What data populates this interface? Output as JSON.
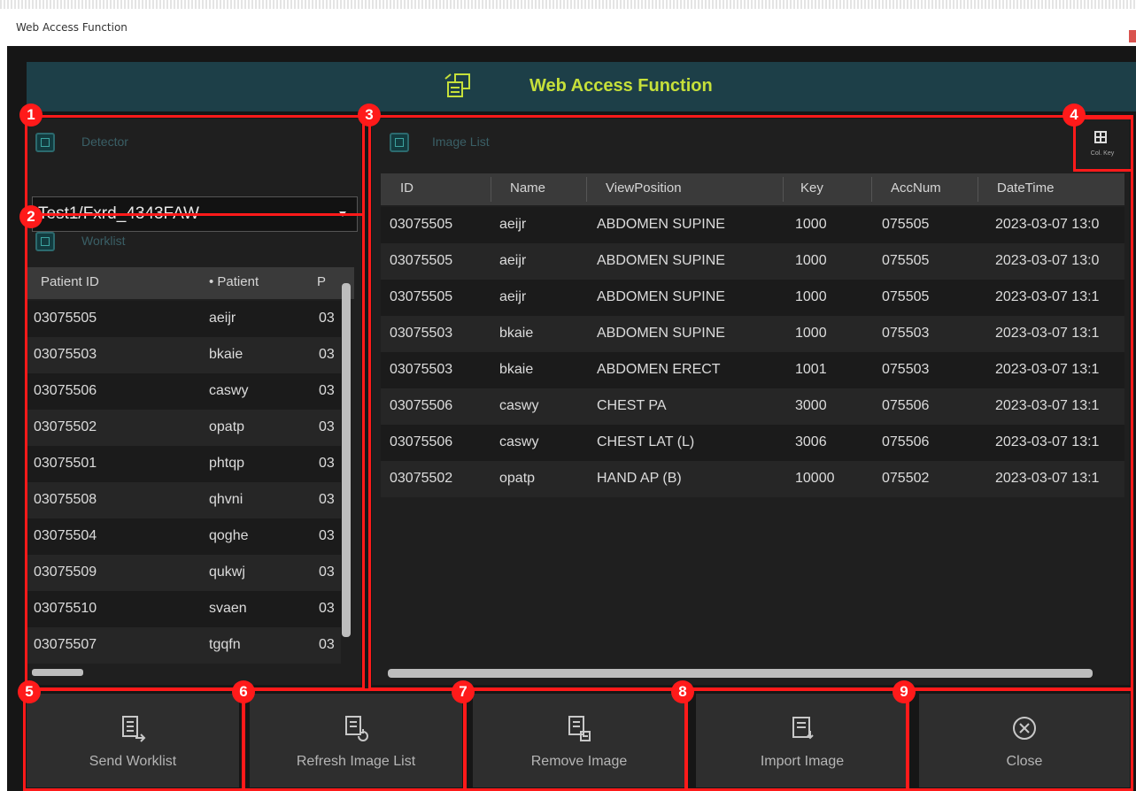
{
  "window": {
    "title": "Web Access Function"
  },
  "header": {
    "title": "Web Access Function"
  },
  "detector": {
    "label": "Detector",
    "selected": "Test1/Fxrd_4343FAW"
  },
  "worklist": {
    "label": "Worklist",
    "columns": [
      "Patient ID",
      "•  Patient",
      "P"
    ],
    "rows": [
      {
        "id": "03075505",
        "name": "aeijr",
        "p": "03"
      },
      {
        "id": "03075503",
        "name": "bkaie",
        "p": "03"
      },
      {
        "id": "03075506",
        "name": "caswy",
        "p": "03"
      },
      {
        "id": "03075502",
        "name": "opatp",
        "p": "03"
      },
      {
        "id": "03075501",
        "name": "phtqp",
        "p": "03"
      },
      {
        "id": "03075508",
        "name": "qhvni",
        "p": "03"
      },
      {
        "id": "03075504",
        "name": "qoghe",
        "p": "03"
      },
      {
        "id": "03075509",
        "name": "qukwj",
        "p": "03"
      },
      {
        "id": "03075510",
        "name": "svaen",
        "p": "03"
      },
      {
        "id": "03075507",
        "name": "tgqfn",
        "p": "03"
      }
    ]
  },
  "image_list": {
    "label": "Image List",
    "column_key_label": "Col. Key",
    "columns": [
      "ID",
      "Name",
      "ViewPosition",
      "Key",
      "AccNum",
      "DateTime"
    ],
    "rows": [
      {
        "id": "03075505",
        "name": "aeijr",
        "view": "ABDOMEN SUPINE",
        "key": "1000",
        "acc": "075505",
        "dt": "2023-03-07 13:0"
      },
      {
        "id": "03075505",
        "name": "aeijr",
        "view": "ABDOMEN SUPINE",
        "key": "1000",
        "acc": "075505",
        "dt": "2023-03-07 13:0"
      },
      {
        "id": "03075505",
        "name": "aeijr",
        "view": "ABDOMEN SUPINE",
        "key": "1000",
        "acc": "075505",
        "dt": "2023-03-07 13:1"
      },
      {
        "id": "03075503",
        "name": "bkaie",
        "view": "ABDOMEN SUPINE",
        "key": "1000",
        "acc": "075503",
        "dt": "2023-03-07 13:1"
      },
      {
        "id": "03075503",
        "name": "bkaie",
        "view": "ABDOMEN ERECT",
        "key": "1001",
        "acc": "075503",
        "dt": "2023-03-07 13:1"
      },
      {
        "id": "03075506",
        "name": "caswy",
        "view": "CHEST PA",
        "key": "3000",
        "acc": "075506",
        "dt": "2023-03-07 13:1"
      },
      {
        "id": "03075506",
        "name": "caswy",
        "view": "CHEST LAT (L)",
        "key": "3006",
        "acc": "075506",
        "dt": "2023-03-07 13:1"
      },
      {
        "id": "03075502",
        "name": "opatp",
        "view": "HAND AP (B)",
        "key": "10000",
        "acc": "075502",
        "dt": "2023-03-07 13:1"
      }
    ]
  },
  "actions": {
    "send_worklist": "Send Worklist",
    "refresh_image_list": "Refresh Image List",
    "remove_image": "Remove Image",
    "import_image": "Import Image",
    "close": "Close"
  },
  "callouts": [
    "1",
    "2",
    "3",
    "4",
    "5",
    "6",
    "7",
    "8",
    "9"
  ],
  "colors": {
    "callout_red": "#ff1a1a",
    "header_title": "#c6e03a",
    "header_bg": "#1d3f48",
    "window_bg": "#161616"
  }
}
